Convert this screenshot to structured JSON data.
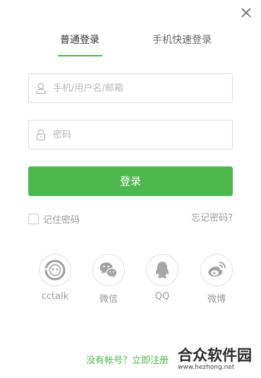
{
  "colors": {
    "accent": "#4cb84e",
    "text": "#333333",
    "muted": "#999999",
    "border": "#dcdcdc"
  },
  "tabs": {
    "normal_label": "普通登录",
    "quick_label": "手机快速登录",
    "active": "normal_label"
  },
  "form": {
    "username_placeholder": "手机/用户名/邮箱",
    "username_value": "",
    "password_placeholder": "密码",
    "password_value": "",
    "login_label": "登录",
    "remember_label": "记住密码",
    "remember_checked": false,
    "forgot_label": "忘记密码?"
  },
  "social": {
    "items": [
      {
        "label": "cctalk",
        "icon": "cctalk-icon"
      },
      {
        "label": "微信",
        "icon": "wechat-icon"
      },
      {
        "label": "QQ",
        "icon": "qq-icon"
      },
      {
        "label": "微博",
        "icon": "weibo-icon"
      }
    ]
  },
  "register": {
    "label": "没有帐号？立即注册"
  },
  "watermark": {
    "name": "合众软件园",
    "url": "www.hezhong.net"
  },
  "icons": {
    "close": "close-icon",
    "user": "user-icon",
    "lock": "lock-icon"
  }
}
